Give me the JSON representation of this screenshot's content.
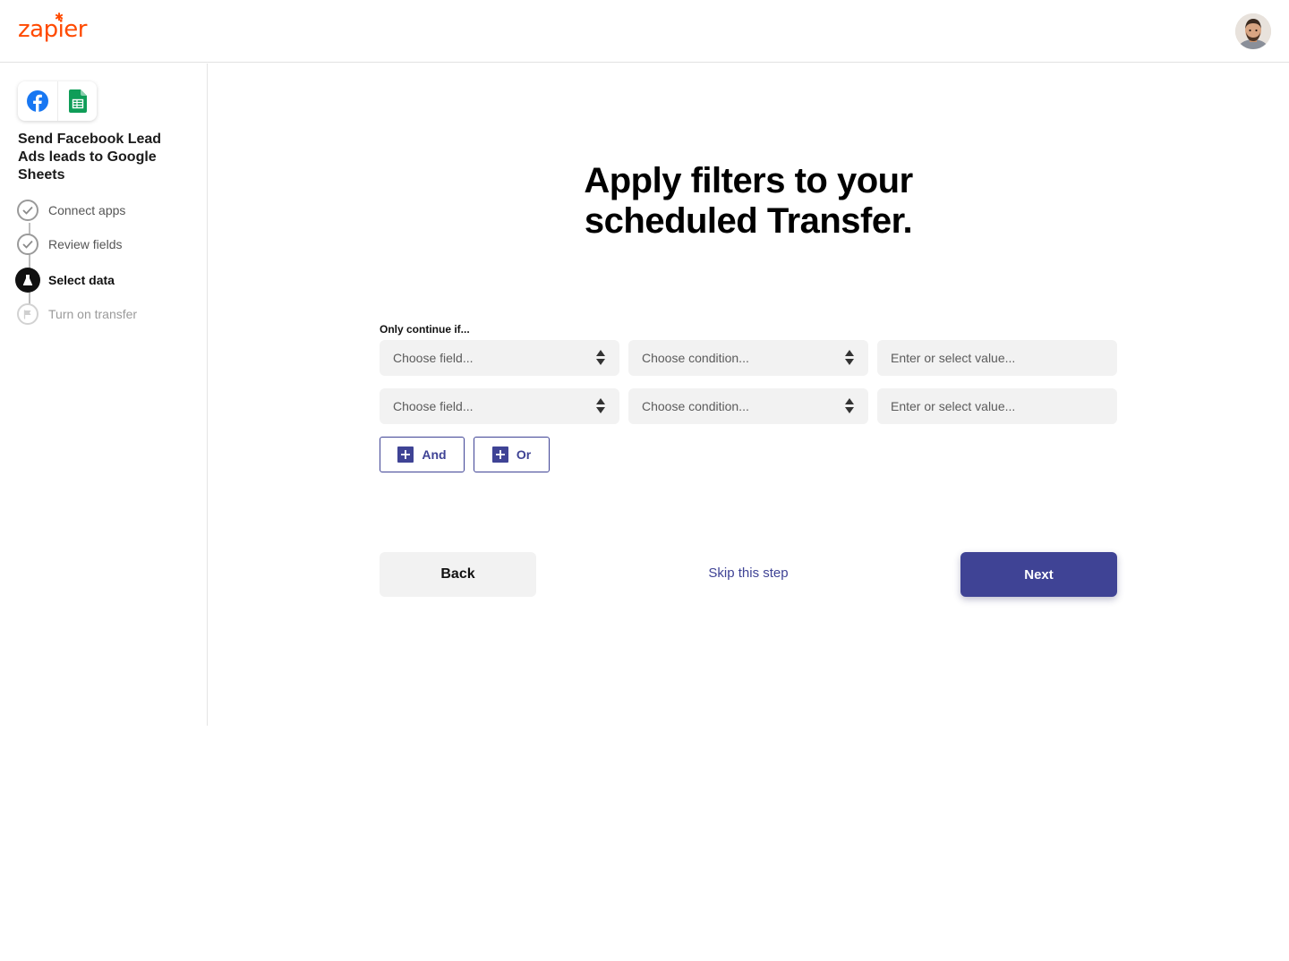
{
  "header": {
    "logo_text": "zapier",
    "avatar_alt": "user-avatar"
  },
  "sidebar": {
    "zap_title": "Send Facebook Lead Ads leads to Google Sheets",
    "app_icons": [
      "facebook-icon",
      "google-sheets-icon"
    ],
    "steps": [
      {
        "label": "Connect apps",
        "state": "complete"
      },
      {
        "label": "Review fields",
        "state": "complete"
      },
      {
        "label": "Select data",
        "state": "active"
      },
      {
        "label": "Turn on transfer",
        "state": "disabled"
      }
    ]
  },
  "main": {
    "heading_line1": "Apply filters to your",
    "heading_line2": "scheduled Transfer.",
    "filter_label": "Only continue if...",
    "rows": [
      {
        "field_placeholder": "Choose field...",
        "condition_placeholder": "Choose condition...",
        "value_placeholder": "Enter or select value..."
      },
      {
        "field_placeholder": "Choose field...",
        "condition_placeholder": "Choose condition...",
        "value_placeholder": "Enter or select value..."
      }
    ],
    "and_label": "And",
    "or_label": "Or",
    "back_label": "Back",
    "skip_label": "Skip this step",
    "next_label": "Next"
  },
  "colors": {
    "brand_orange": "#ff4a00",
    "primary": "#3f4395",
    "field_bg": "#f2f2f2"
  }
}
